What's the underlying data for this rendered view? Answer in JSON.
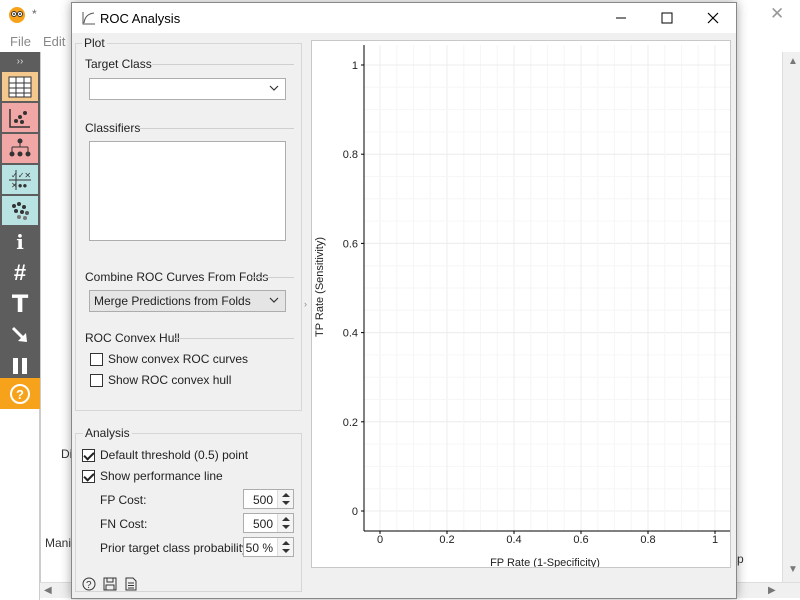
{
  "background_app": {
    "title_suffix": "*",
    "menu": [
      "File",
      "Edit"
    ],
    "canvas_texts": [
      "Di",
      "Mani",
      "p"
    ]
  },
  "dialog": {
    "title": "ROC Analysis",
    "controls": {
      "plot_box_title": "Plot",
      "target_class_label": "Target Class",
      "target_class_value": "",
      "classifiers_label": "Classifiers",
      "classifiers_items": [],
      "combine_label": "Combine ROC Curves From Folds",
      "combine_value": "Merge Predictions from Folds",
      "convex_hull_label": "ROC Convex Hull",
      "show_convex_curves": {
        "label": "Show convex ROC curves",
        "checked": false
      },
      "show_convex_hull": {
        "label": "Show ROC convex hull",
        "checked": false
      },
      "analysis_box_title": "Analysis",
      "default_threshold": {
        "label": "Default threshold (0.5) point",
        "checked": true
      },
      "show_performance_line": {
        "label": "Show performance line",
        "checked": true
      },
      "fp_cost": {
        "label": "FP Cost:",
        "value": "500"
      },
      "fn_cost": {
        "label": "FN Cost:",
        "value": "500"
      },
      "prior_prob": {
        "label": "Prior target class probability:",
        "value": "50 %"
      }
    },
    "footer_icons": [
      "help-icon",
      "save-icon",
      "report-icon"
    ]
  },
  "chart_data": {
    "type": "line",
    "title": "",
    "xlabel": "FP Rate (1-Specificity)",
    "ylabel": "TP Rate (Sensitivity)",
    "xlim": [
      0,
      1
    ],
    "ylim": [
      0,
      1
    ],
    "x_ticks": [
      "0",
      "0.2",
      "0.4",
      "0.6",
      "0.8",
      "1"
    ],
    "y_ticks": [
      "0",
      "0.2",
      "0.4",
      "0.6",
      "0.8",
      "1"
    ],
    "grid": true,
    "series": []
  }
}
